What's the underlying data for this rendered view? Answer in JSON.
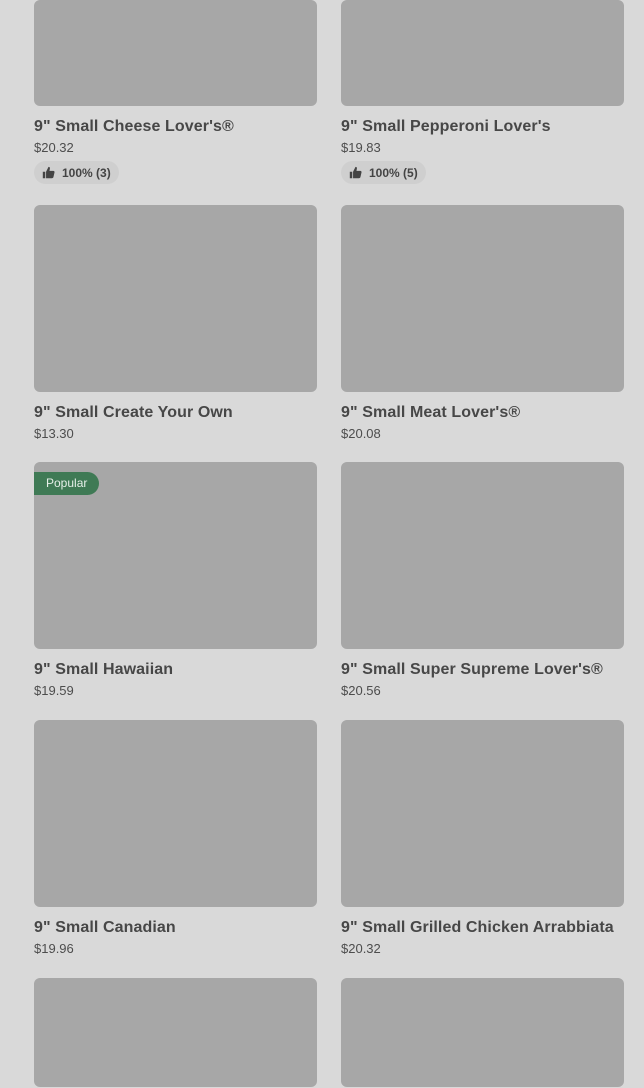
{
  "products": [
    {
      "name": "9\"  Small Cheese Lover's®",
      "price": "$20.32",
      "rating": "100% (3)"
    },
    {
      "name": "9\"  Small Pepperoni Lover's",
      "price": "$19.83",
      "rating": "100% (5)"
    },
    {
      "name": "9\"  Small Create Your Own",
      "price": "$13.30"
    },
    {
      "name": "9\"  Small Meat Lover's®",
      "price": "$20.08"
    },
    {
      "name": "9\"  Small Hawaiian",
      "price": "$19.59",
      "badge": "Popular"
    },
    {
      "name": "9\"  Small Super Supreme Lover's®",
      "price": "$20.56"
    },
    {
      "name": "9\"  Small Canadian",
      "price": "$19.96"
    },
    {
      "name": "9\"  Small Grilled Chicken Arrabbiata",
      "price": "$20.32"
    }
  ],
  "colors": {
    "background": "#d9d9d9",
    "image_placeholder": "#a7a7a7",
    "badge_bg": "#3f7a55",
    "rating_bg": "#cfcfcf"
  },
  "icons": {
    "rating": "thumbs-up-icon"
  }
}
